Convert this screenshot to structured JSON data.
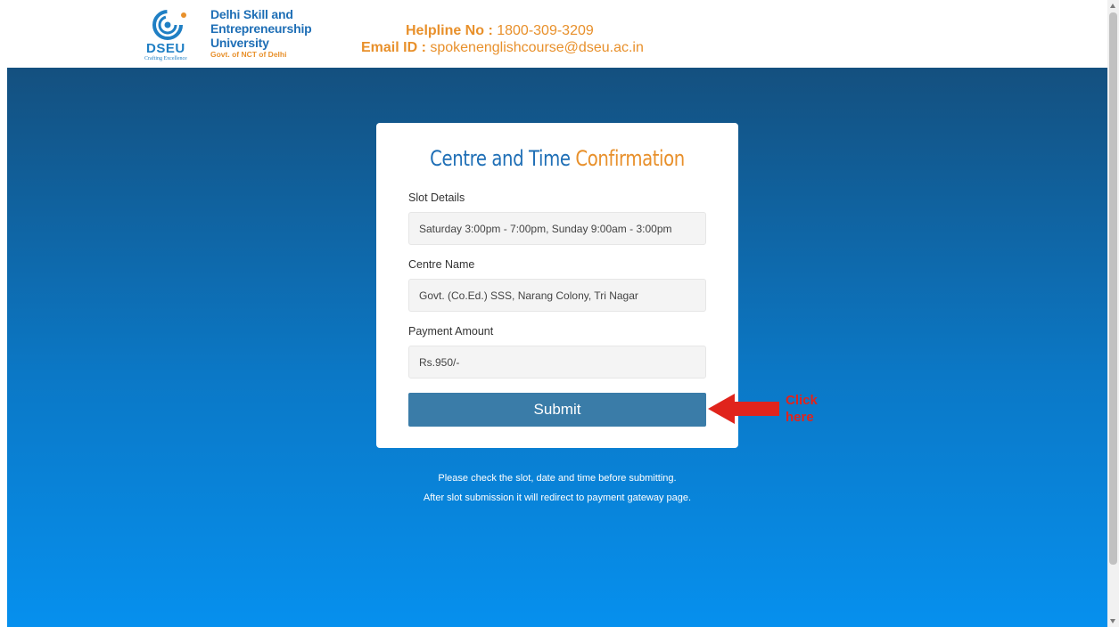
{
  "header": {
    "logo_text": "DSEU",
    "logo_tagline": "Crafting Excellence",
    "university_line1": "Delhi Skill and",
    "university_line2": "Entrepreneurship University",
    "university_line3": "Govt. of NCT of Delhi",
    "helpline_label": "Helpline No :",
    "helpline_value": "1800-309-3209",
    "email_label": "Email ID :",
    "email_value": "spokenenglishcourse@dseu.ac.in"
  },
  "card": {
    "title_part1": "Centre and Time",
    "title_part2": "Confirmation",
    "fields": [
      {
        "label": "Slot Details",
        "value": "Saturday 3:00pm - 7:00pm, Sunday 9:00am - 3:00pm"
      },
      {
        "label": "Centre Name",
        "value": "Govt. (Co.Ed.) SSS, Narang Colony, Tri Nagar"
      },
      {
        "label": "Payment Amount",
        "value": "Rs.950/-"
      }
    ],
    "submit_label": "Submit"
  },
  "annotation": {
    "click_line1": "Click",
    "click_line2": "here"
  },
  "notes": {
    "line1": "Please check the slot, date and time before submitting.",
    "line2": "After slot submission it will redirect to payment gateway page."
  },
  "colors": {
    "brand_blue": "#1f6fb6",
    "brand_orange": "#e8902b",
    "button": "#3a7ca8",
    "annotation_red": "#e0241c"
  }
}
